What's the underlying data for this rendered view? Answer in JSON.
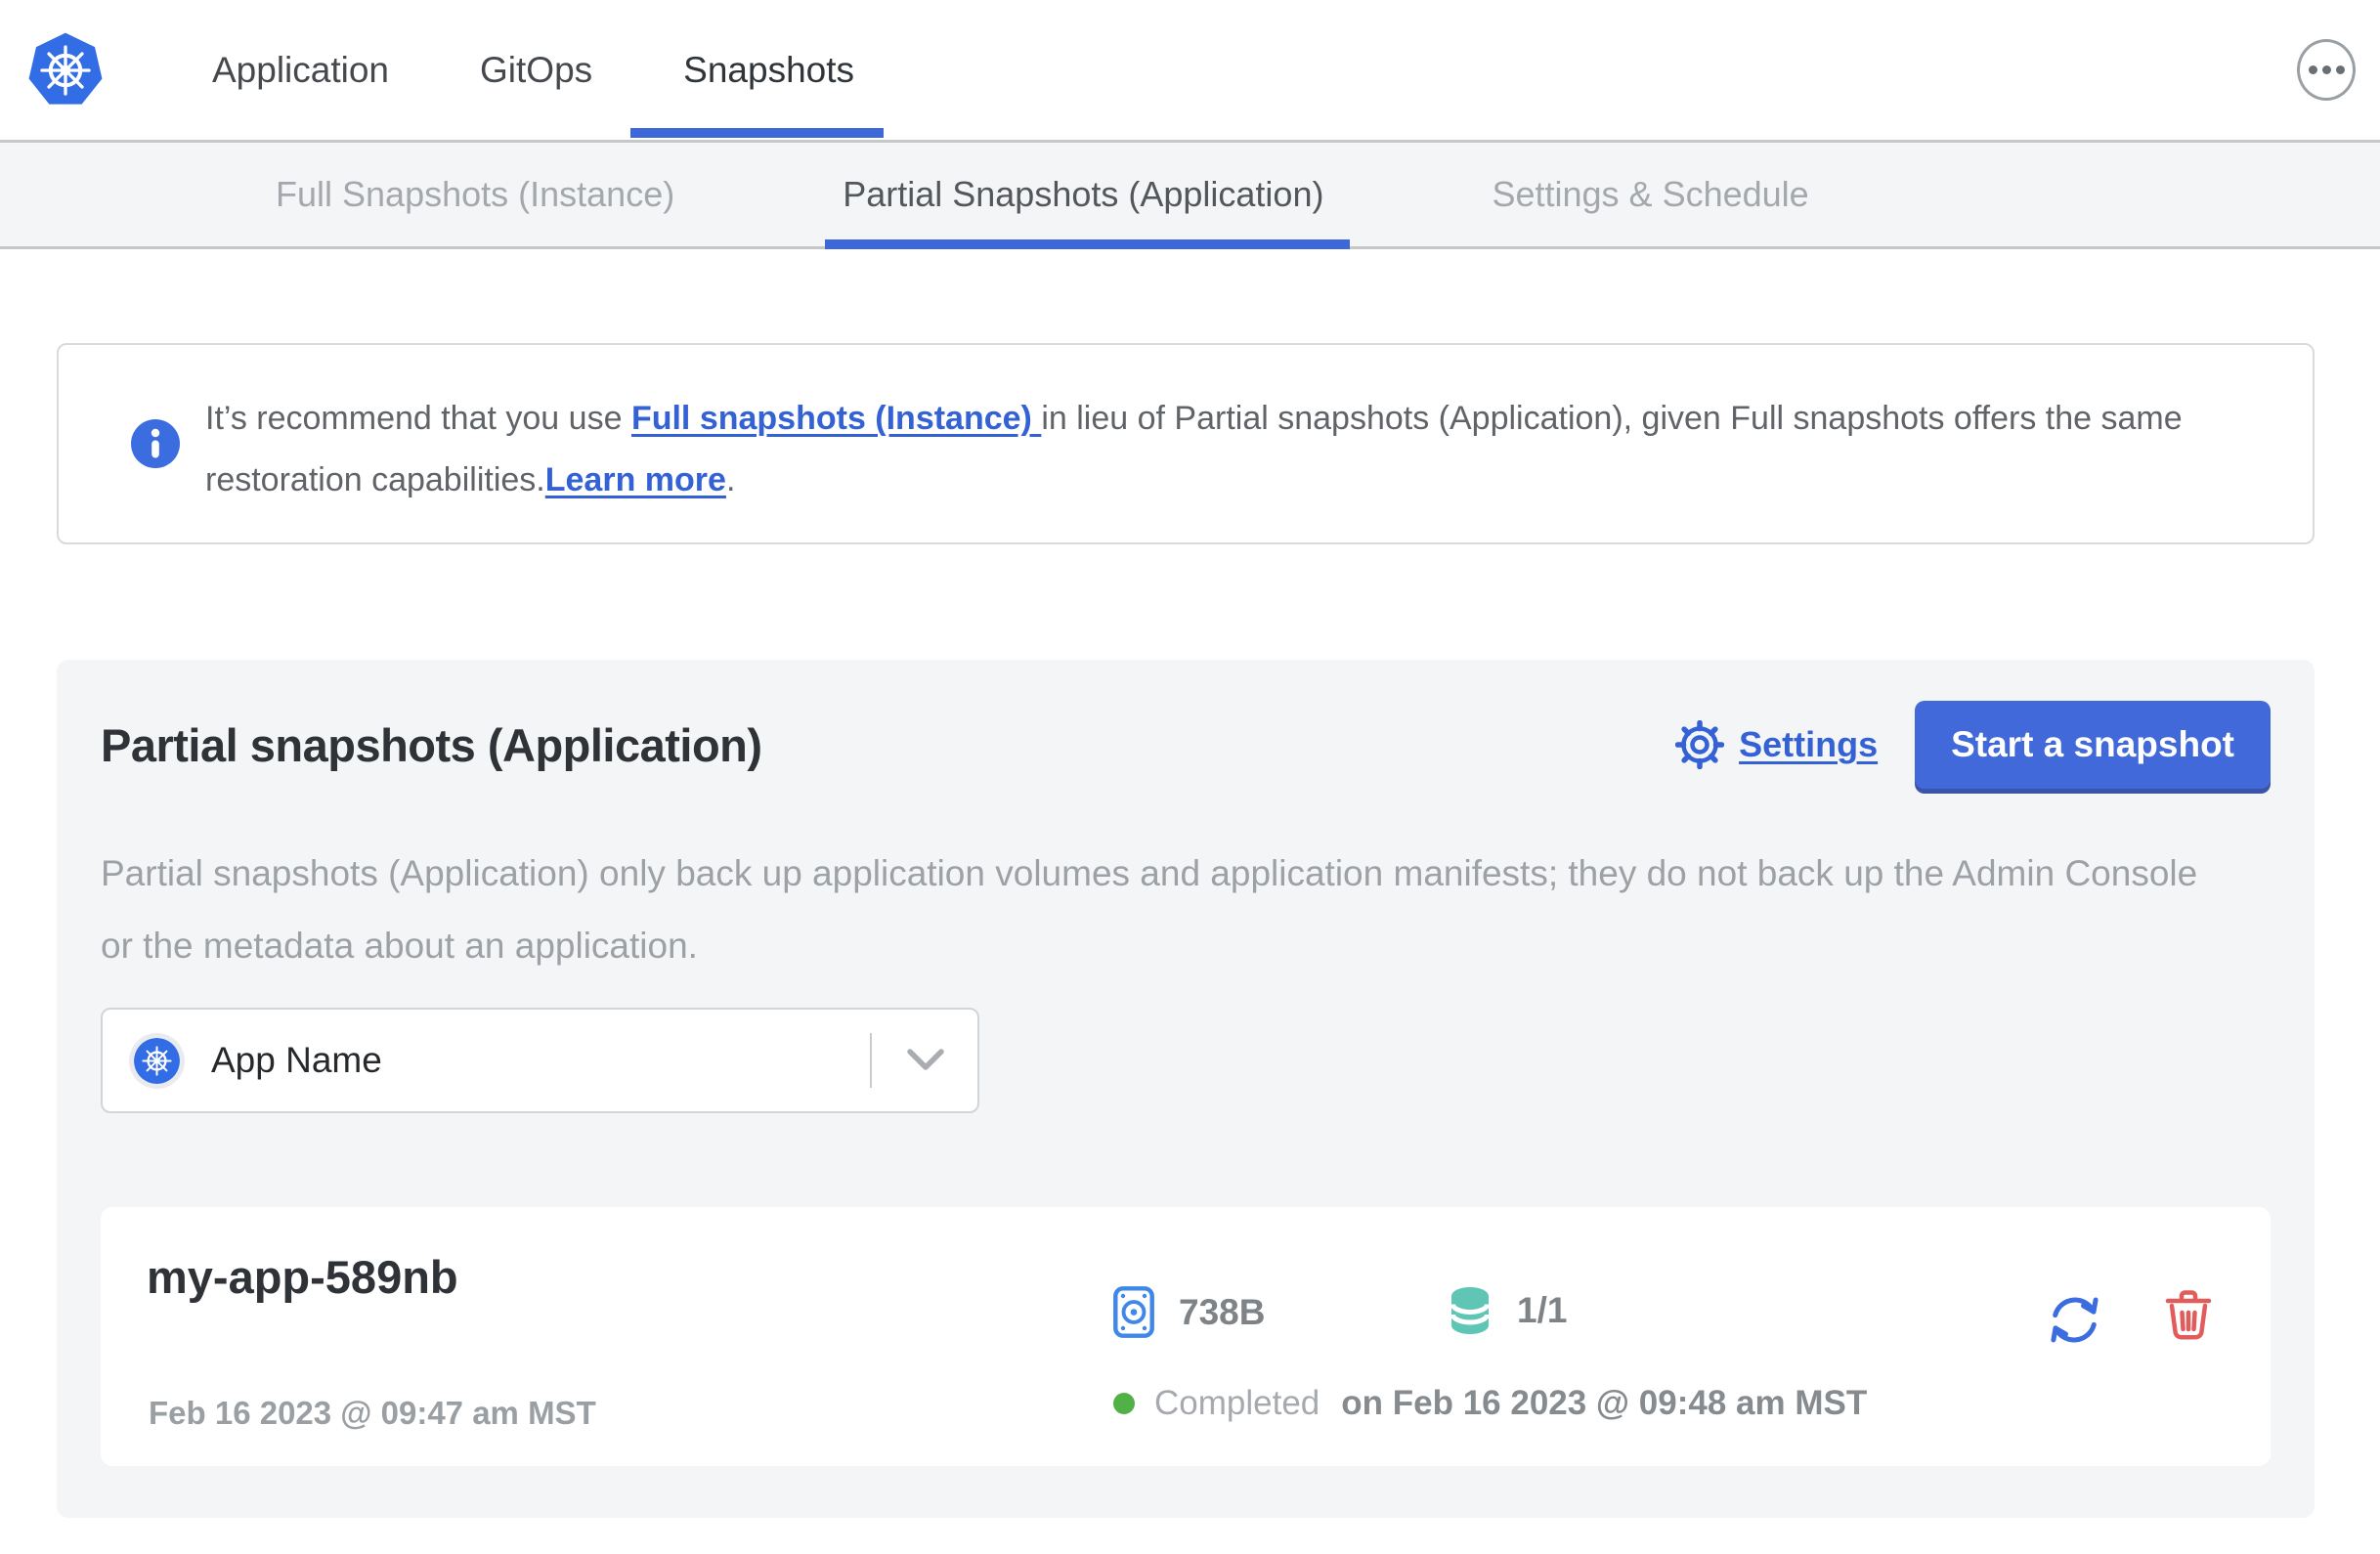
{
  "header": {
    "nav": [
      {
        "label": "Application",
        "active": false
      },
      {
        "label": "GitOps",
        "active": false
      },
      {
        "label": "Snapshots",
        "active": true
      }
    ],
    "more_menu_icon": "ellipsis-icon"
  },
  "subnav": [
    {
      "label": "Full Snapshots (Instance)",
      "active": false
    },
    {
      "label": "Partial Snapshots (Application)",
      "active": true
    },
    {
      "label": "Settings & Schedule",
      "active": false
    }
  ],
  "banner": {
    "icon": "info-icon",
    "intro": "It’s recommend that you use ",
    "link_full_snapshots": "Full snapshots (Instance) ",
    "middle": "in lieu of Partial snapshots (Application), given Full snapshots offers the same restoration capabilities.",
    "link_learn_more": "Learn more",
    "suffix": "."
  },
  "panel": {
    "title": "Partial snapshots (Application)",
    "settings_link": "Settings",
    "start_snapshot_button": "Start a snapshot",
    "description": "Partial snapshots (Application) only back up application volumes and application manifests; they do not back up the Admin Console or the metadata about an application.",
    "app_selector_value": "App Name",
    "snapshot": {
      "name": "my-app-589nb",
      "started_at": "Feb 16 2023 @ 09:47 am MST",
      "size": "738B",
      "volumes": "1/1",
      "status": "Completed",
      "completed_at": "on Feb 16 2023 @ 09:48 am MST"
    }
  },
  "colors": {
    "primary_blue": "#3e68d9",
    "kubernetes_blue": "#326de6",
    "link_blue": "#3462d5",
    "disk_icon_blue": "#3f87e8",
    "volume_teal": "#5fc6b6",
    "success_green": "#51b146",
    "danger_red": "#e25c5c",
    "panel_gray": "#f4f5f7"
  }
}
